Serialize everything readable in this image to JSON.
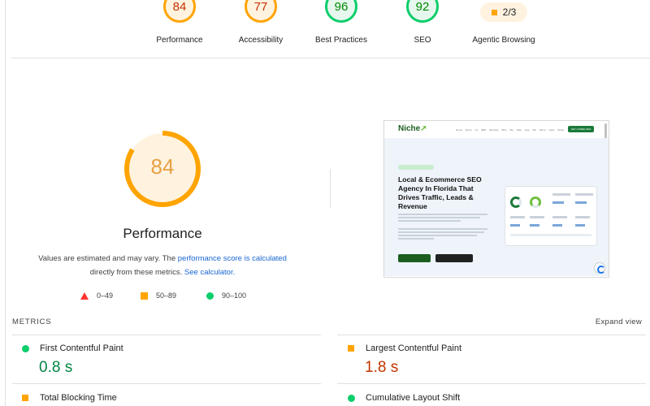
{
  "categories": [
    {
      "score": "84",
      "label": "Performance",
      "status": "orange"
    },
    {
      "score": "77",
      "label": "Accessibility",
      "status": "orange"
    },
    {
      "score": "96",
      "label": "Best Practices",
      "status": "green"
    },
    {
      "score": "92",
      "label": "SEO",
      "status": "green"
    }
  ],
  "agentic": {
    "value": "2/3",
    "label": "Agentic Browsing"
  },
  "main": {
    "score": "84",
    "score_fraction": 0.84,
    "title": "Performance",
    "desc_prefix": "Values are estimated and may vary. The ",
    "desc_link1": "performance score is calculated",
    "desc_middle": "directly from these metrics. ",
    "desc_link2": "See calculator."
  },
  "legend": {
    "fail": "0–49",
    "average": "50–89",
    "pass": "90–100"
  },
  "screenshot": {
    "logo_text": "Niche",
    "nav_text": "Home About Us SEO Services Who We Help How We Serve Case Study",
    "cta_text": "GET A FREE SEO AUDIT",
    "headline": "Local & Ecommerce SEO Agency In Florida That Drives Traffic, Leads & Revenue"
  },
  "metrics": {
    "header": "METRICS",
    "expand_label": "Expand view",
    "fcp": {
      "label": "First Contentful Paint",
      "value": "0.8 s"
    },
    "lcp": {
      "label": "Largest Contentful Paint",
      "value": "1.8 s"
    },
    "tbt": {
      "label": "Total Blocking Time"
    },
    "cls": {
      "label": "Cumulative Layout Shift"
    }
  },
  "colors": {
    "pass": "#0cce6b",
    "average": "#ffa400",
    "fail": "#ff3333",
    "link": "#1967d2"
  }
}
